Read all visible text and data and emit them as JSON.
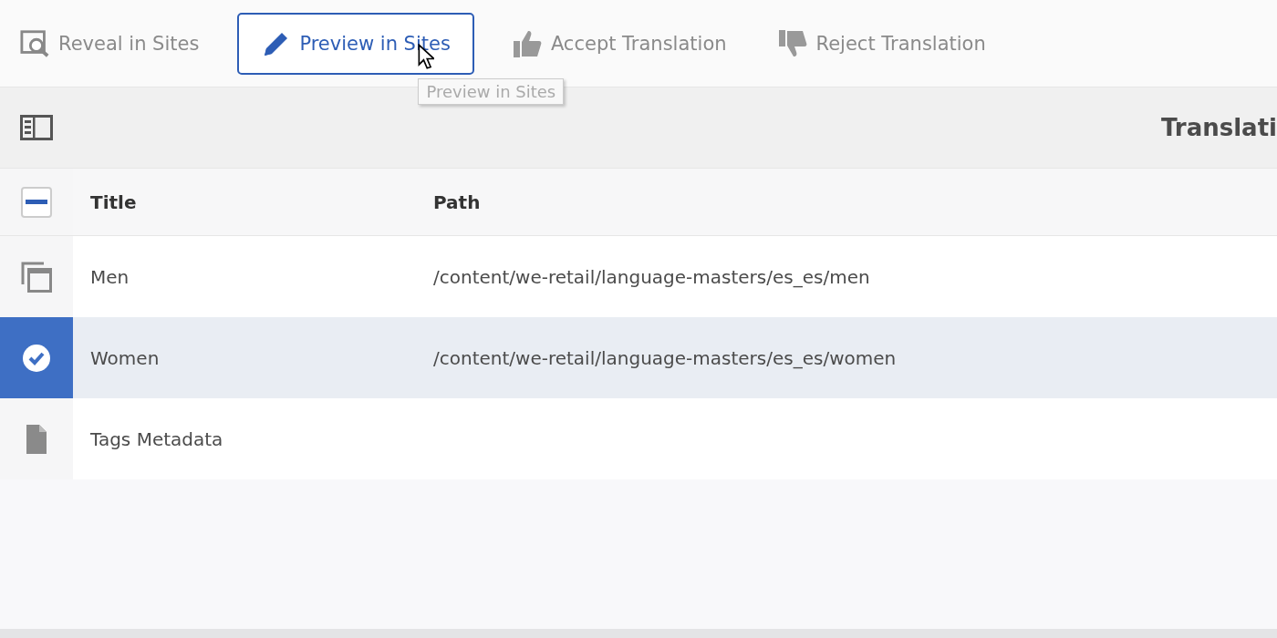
{
  "toolbar": {
    "buttons": [
      {
        "kind": "reveal",
        "label": "Reveal in Sites",
        "focused": false
      },
      {
        "kind": "preview",
        "label": "Preview in Sites",
        "focused": true
      },
      {
        "kind": "accept",
        "label": "Accept Translation",
        "focused": false
      },
      {
        "kind": "reject",
        "label": "Reject Translation",
        "focused": false
      }
    ],
    "tooltip": "Preview in Sites"
  },
  "header": {
    "title": "Translati"
  },
  "table": {
    "select_all_partial": true,
    "columns": [
      "Title",
      "Path"
    ],
    "rows": [
      {
        "kind": "pages",
        "title": "Men",
        "path": "/content/we-retail/language-masters/es_es/men",
        "selected": false
      },
      {
        "title": "Women",
        "path": "/content/we-retail/language-masters/es_es/women",
        "selected": true
      },
      {
        "kind": "document",
        "title": "Tags Metadata",
        "selected": false
      }
    ]
  }
}
